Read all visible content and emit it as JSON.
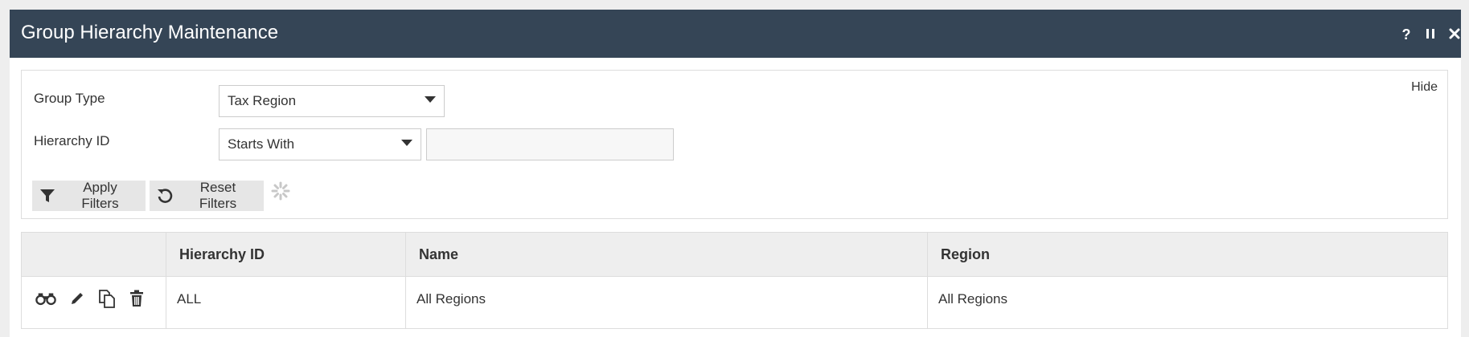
{
  "window": {
    "title": "Group Hierarchy Maintenance",
    "titlebar_color": "#354556",
    "buttons": [
      "help-icon",
      "pause-icon",
      "close-icon"
    ]
  },
  "filters": {
    "hide_label": "Hide",
    "group_type": {
      "label": "Group Type",
      "selected": "Tax Region"
    },
    "hierarchy_id": {
      "label": "Hierarchy ID",
      "operator": "Starts With",
      "value": ""
    },
    "apply_label": "Apply Filters",
    "reset_label": "Reset Filters"
  },
  "grid": {
    "columns": [
      "",
      "Hierarchy ID",
      "Name",
      "Region"
    ],
    "rows": [
      {
        "actions": [
          "view-icon",
          "edit-icon",
          "copy-icon",
          "delete-icon"
        ],
        "hierarchy_id": "ALL",
        "name": "All Regions",
        "region": "All Regions"
      }
    ]
  }
}
